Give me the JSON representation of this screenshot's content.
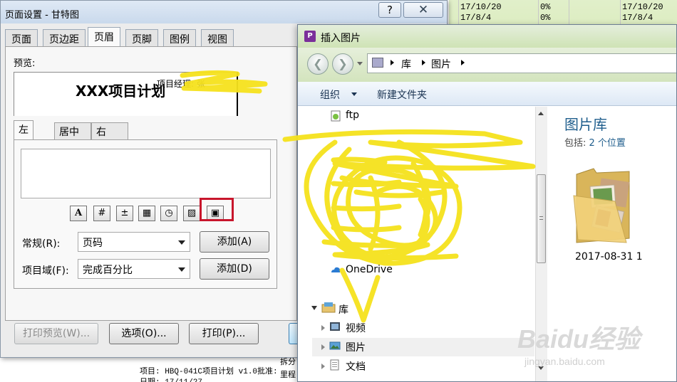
{
  "background": {
    "rows_right": [
      {
        "date1": "17/10/20",
        "pct": "0%",
        "date2": "17/10/20"
      },
      {
        "date1": "17/8/4",
        "pct": "0%",
        "date2": "17/8/4"
      }
    ],
    "footer_line1": "项目: HBQ-041C项目计划 v1.0批准:",
    "footer_line2": "日期: 17/11/27",
    "footer_right1": "拆分",
    "footer_right2": "里程"
  },
  "page_setup": {
    "title": "页面设置 - 甘特图",
    "help_label": "?",
    "close_label": "✕",
    "tabs": [
      "页面",
      "页边距",
      "页眉",
      "页脚",
      "图例",
      "视图"
    ],
    "active_tab": "页眉",
    "preview_label": "预览:",
    "preview_title": "XXX项目计划",
    "preview_manager": "项目经理: 张",
    "header_tabs": [
      "左",
      "居中",
      "右"
    ],
    "active_header_tab": "左",
    "format_buttons": [
      {
        "icon": "font-icon",
        "glyph": "A"
      },
      {
        "icon": "page-number-icon",
        "glyph": "#"
      },
      {
        "icon": "total-pages-icon",
        "glyph": "±"
      },
      {
        "icon": "date-icon",
        "glyph": "▦"
      },
      {
        "icon": "time-icon",
        "glyph": "◷"
      },
      {
        "icon": "file-name-icon",
        "glyph": "▨"
      },
      {
        "icon": "insert-picture-icon",
        "glyph": "▣"
      }
    ],
    "general_label": "常规(R):",
    "general_value": "页码",
    "general_add": "添加(A)",
    "field_label": "项目域(F):",
    "field_value": "完成百分比",
    "field_add": "添加(D)",
    "print_preview": "打印预览(W)...",
    "options": "选项(O)...",
    "print": "打印(P)..."
  },
  "insert_picture": {
    "app_icon": "P",
    "title": "插入图片",
    "breadcrumb": [
      "库",
      "图片"
    ],
    "organize": "组织",
    "new_folder": "新建文件夹",
    "nav_items": [
      {
        "label": "ftp"
      },
      {
        "label": "OneDrive"
      },
      {
        "label": "库"
      },
      {
        "label": "视频"
      },
      {
        "label": "图片"
      },
      {
        "label": "文档"
      }
    ],
    "library_title": "图片库",
    "includes_label": "包括:",
    "includes_link": "2 个位置",
    "folder_label": "2017-08-31 1"
  },
  "watermark": {
    "logo": "Baidu经验",
    "url": "jingyan.baidu.com"
  },
  "colors": {
    "scribble": "#f5e21c",
    "highlight": "#c8162c",
    "library_title": "#1e5d8c"
  }
}
